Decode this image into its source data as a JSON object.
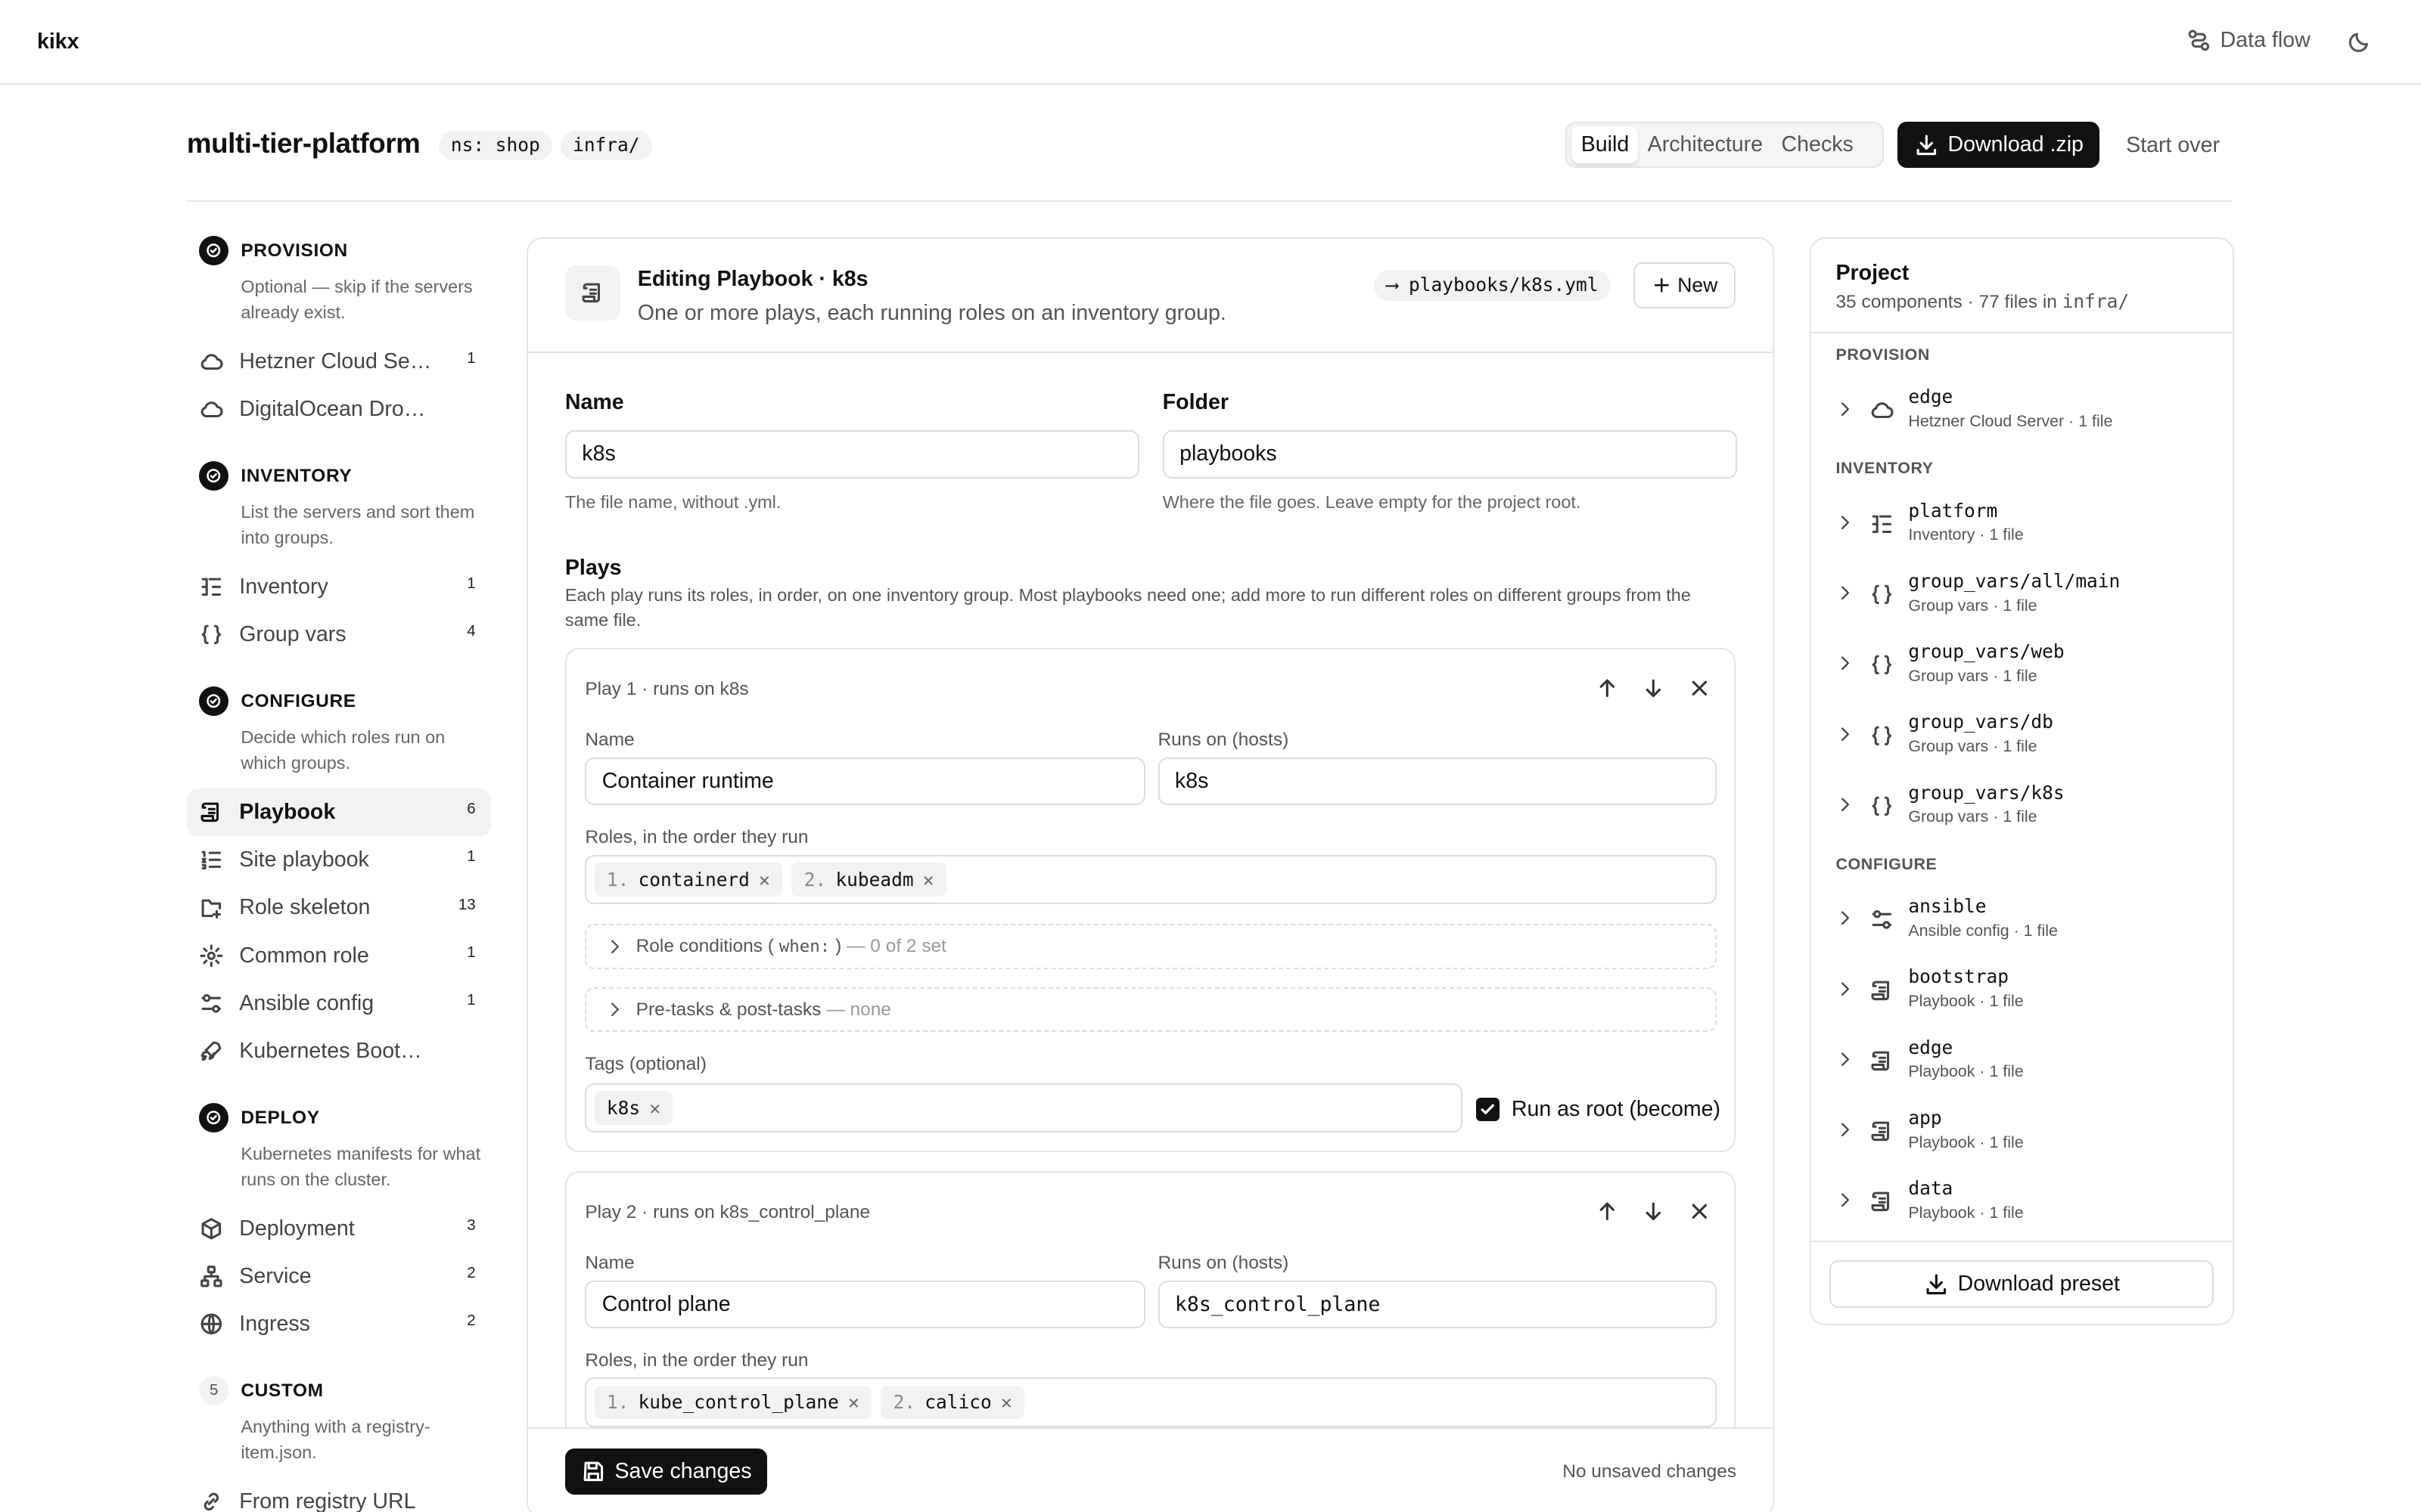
{
  "brand": "kikx",
  "topbar": {
    "data_flow_label": "Data flow"
  },
  "project": {
    "title": "multi-tier-platform",
    "namespace_chip": "ns: shop",
    "folder_chip": "infra/"
  },
  "view_tabs": [
    "Build",
    "Architecture",
    "Checks"
  ],
  "download_zip_label": "Download .zip",
  "start_over_label": "Start over",
  "sidebar": {
    "sections": [
      {
        "id": "provision",
        "title": "PROVISION",
        "desc": "Optional — skip if the servers already exist.",
        "items": [
          {
            "label": "Hetzner Cloud Server",
            "count": "1",
            "icon": "cloud-icon"
          },
          {
            "label": "DigitalOcean Droplet",
            "count": "",
            "icon": "cloud-icon"
          }
        ]
      },
      {
        "id": "inventory",
        "title": "INVENTORY",
        "desc": "List the servers and sort them into groups.",
        "items": [
          {
            "label": "Inventory",
            "count": "1",
            "icon": "tree-list-icon"
          },
          {
            "label": "Group vars",
            "count": "4",
            "icon": "braces-icon"
          }
        ]
      },
      {
        "id": "configure",
        "title": "CONFIGURE",
        "desc": "Decide which roles run on which groups.",
        "items": [
          {
            "label": "Playbook",
            "count": "6",
            "icon": "scroll-icon"
          },
          {
            "label": "Site playbook",
            "count": "1",
            "icon": "list-ordered-icon"
          },
          {
            "label": "Role skeleton",
            "count": "13",
            "icon": "folder-plus-icon"
          },
          {
            "label": "Common role",
            "count": "1",
            "icon": "gear-icon"
          },
          {
            "label": "Ansible config",
            "count": "1",
            "icon": "sliders-icon"
          },
          {
            "label": "Kubernetes Bootstrap",
            "count": "",
            "icon": "rocket-icon"
          }
        ]
      },
      {
        "id": "deploy",
        "title": "DEPLOY",
        "desc": "Kubernetes manifests for what runs on the cluster.",
        "items": [
          {
            "label": "Deployment",
            "count": "3",
            "icon": "box-icon"
          },
          {
            "label": "Service",
            "count": "2",
            "icon": "network-icon"
          },
          {
            "label": "Ingress",
            "count": "2",
            "icon": "globe-icon"
          }
        ]
      },
      {
        "id": "custom",
        "number": "5",
        "title": "CUSTOM",
        "desc": "Anything with a registry-item.json.",
        "items": [
          {
            "label": "From registry URL",
            "count": "",
            "icon": "link-icon"
          }
        ]
      }
    ]
  },
  "editor": {
    "title": "Editing Playbook · k8s",
    "subtitle": "One or more plays, each running roles on an inventory group.",
    "path": "playbooks/k8s.yml",
    "path_arrow": "⟶",
    "new_label": "New",
    "name_label": "Name",
    "name_value": "k8s",
    "name_help": "The file name, without .yml.",
    "folder_label": "Folder",
    "folder_value": "playbooks",
    "folder_help": "Where the file goes. Leave empty for the project root.",
    "plays_title": "Plays",
    "plays_desc": "Each play runs its roles, in order, on one inventory group. Most playbooks need one; add more to run different roles on different groups from the same file.",
    "plays": [
      {
        "title": "Play 1 · runs on k8s",
        "name_label": "Name",
        "name": "Container runtime",
        "hosts_label": "Runs on (hosts)",
        "hosts": "k8s",
        "roles_label": "Roles, in the order they run",
        "roles": [
          {
            "n": "1.",
            "name": "containerd"
          },
          {
            "n": "2.",
            "name": "kubeadm"
          }
        ],
        "conditions_label": "Role conditions (",
        "conditions_code": "when:",
        "conditions_close": ")",
        "conditions_meta": "— 0 of 2 set",
        "tasks_label": "Pre-tasks & post-tasks",
        "tasks_meta": "— none",
        "tags_label": "Tags (optional)",
        "tags": [
          "k8s"
        ],
        "become_label": "Run as root (become)"
      },
      {
        "title": "Play 2 · runs on k8s_control_plane",
        "name_label": "Name",
        "name": "Control plane",
        "hosts_label": "Runs on (hosts)",
        "hosts": "k8s_control_plane",
        "roles_label": "Roles, in the order they run",
        "roles": [
          {
            "n": "1.",
            "name": "kube_control_plane"
          },
          {
            "n": "2.",
            "name": "calico"
          }
        ]
      }
    ],
    "save_label": "Save changes",
    "status": "No unsaved changes"
  },
  "project_panel": {
    "title": "Project",
    "summary_prefix": "35 components · 77 files in",
    "summary_folder": "infra/",
    "sections": [
      {
        "title": "PROVISION",
        "items": [
          {
            "name": "edge",
            "meta": "Hetzner Cloud Server · 1 file",
            "icon": "cloud-icon"
          }
        ]
      },
      {
        "title": "INVENTORY",
        "items": [
          {
            "name": "platform",
            "meta": "Inventory · 1 file",
            "icon": "tree-list-icon"
          },
          {
            "name": "group_vars/all/main",
            "meta": "Group vars · 1 file",
            "icon": "braces-icon"
          },
          {
            "name": "group_vars/web",
            "meta": "Group vars · 1 file",
            "icon": "braces-icon"
          },
          {
            "name": "group_vars/db",
            "meta": "Group vars · 1 file",
            "icon": "braces-icon"
          },
          {
            "name": "group_vars/k8s",
            "meta": "Group vars · 1 file",
            "icon": "braces-icon"
          }
        ]
      },
      {
        "title": "CONFIGURE",
        "items": [
          {
            "name": "ansible",
            "meta": "Ansible config · 1 file",
            "icon": "sliders-icon"
          },
          {
            "name": "bootstrap",
            "meta": "Playbook · 1 file",
            "icon": "scroll-icon"
          },
          {
            "name": "edge",
            "meta": "Playbook · 1 file",
            "icon": "scroll-icon"
          },
          {
            "name": "app",
            "meta": "Playbook · 1 file",
            "icon": "scroll-icon"
          },
          {
            "name": "data",
            "meta": "Playbook · 1 file",
            "icon": "scroll-icon"
          }
        ]
      }
    ],
    "download_preset_label": "Download preset"
  }
}
